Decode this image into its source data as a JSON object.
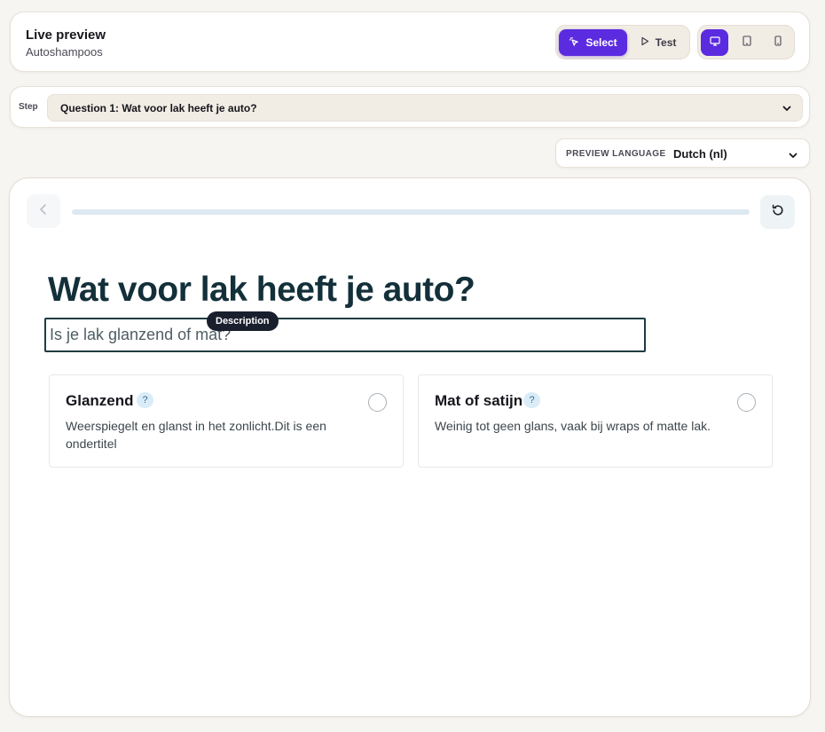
{
  "header": {
    "title": "Live preview",
    "subtitle": "Autoshampoos",
    "mode": {
      "select_label": "Select",
      "test_label": "Test",
      "active": "select"
    },
    "devices": {
      "active": "desktop",
      "items": [
        "desktop-icon",
        "tablet-icon",
        "mobile-icon"
      ]
    }
  },
  "step": {
    "label": "Step",
    "selected": "Question 1: Wat voor lak heeft je auto?"
  },
  "language": {
    "label": "PREVIEW LANGUAGE",
    "value": "Dutch (nl)"
  },
  "preview": {
    "progress": 0,
    "question": "Wat voor lak heeft je auto?",
    "description": "Is je lak glanzend of mat?",
    "description_tag": "Description",
    "help_glyph": "?",
    "options": [
      {
        "title": "Glanzend",
        "subtitle": "Weerspiegelt en glanst in het zonlicht.Dit is een ondertitel",
        "selected": false
      },
      {
        "title": "Mat of satijn",
        "subtitle": "Weinig tot geen glans, vaak bij wraps of matte lak.",
        "selected": false
      }
    ]
  },
  "colors": {
    "accent": "#5b2be0",
    "heading": "#13303a",
    "background": "#f7f5f1"
  }
}
